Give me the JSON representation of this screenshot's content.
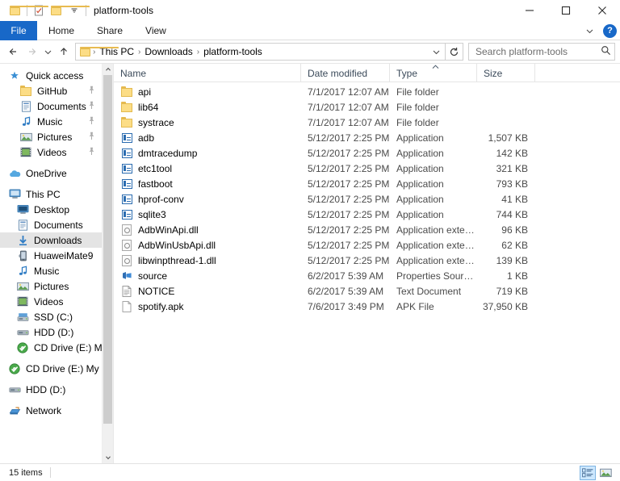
{
  "window": {
    "title": "platform-tools",
    "quick_access_toolbar": [
      {
        "name": "folder-icon",
        "label": ""
      },
      {
        "name": "properties-icon",
        "label": ""
      },
      {
        "name": "new-folder-icon",
        "label": ""
      },
      {
        "name": "chevron-down-icon",
        "label": ""
      }
    ],
    "controls": {
      "minimize": "Minimize",
      "maximize": "Maximize",
      "close": "Close"
    }
  },
  "ribbon": {
    "tabs": [
      {
        "label": "File",
        "active": true
      },
      {
        "label": "Home",
        "active": false
      },
      {
        "label": "Share",
        "active": false
      },
      {
        "label": "View",
        "active": false
      }
    ],
    "expand_label": "",
    "help_label": "?"
  },
  "navigation": {
    "back": "Back",
    "forward": "Forward",
    "recent": "Recent locations",
    "up": "Up",
    "breadcrumbs": [
      "This PC",
      "Downloads",
      "platform-tools"
    ],
    "separator": "›",
    "refresh": "Refresh"
  },
  "search": {
    "placeholder": "Search platform-tools",
    "value": "Search platform-tools"
  },
  "sidebar": {
    "groups": [
      {
        "header": {
          "label": "Quick access",
          "icon": "star-pin-icon"
        },
        "items": [
          {
            "label": "GitHub",
            "icon": "folder-icon",
            "pinned": true,
            "indent": 1
          },
          {
            "label": "Documents",
            "icon": "documents-icon",
            "pinned": true,
            "indent": 1
          },
          {
            "label": "Music",
            "icon": "music-note-icon",
            "pinned": true,
            "indent": 1
          },
          {
            "label": "Pictures",
            "icon": "pictures-icon",
            "pinned": true,
            "indent": 1
          },
          {
            "label": "Videos",
            "icon": "videos-icon",
            "pinned": true,
            "indent": 1
          }
        ]
      },
      {
        "header": {
          "label": "OneDrive",
          "icon": "onedrive-cloud-icon"
        },
        "items": []
      },
      {
        "header": {
          "label": "This PC",
          "icon": "this-pc-icon"
        },
        "items": [
          {
            "label": "Desktop",
            "icon": "desktop-icon",
            "indent": 1
          },
          {
            "label": "Documents",
            "icon": "documents-icon",
            "indent": 1
          },
          {
            "label": "Downloads",
            "icon": "downloads-icon",
            "indent": 1,
            "selected": true
          },
          {
            "label": "HuaweiMate9",
            "icon": "phone-icon",
            "indent": 1
          },
          {
            "label": "Music",
            "icon": "music-note-icon",
            "indent": 1
          },
          {
            "label": "Pictures",
            "icon": "pictures-icon",
            "indent": 1
          },
          {
            "label": "Videos",
            "icon": "videos-icon",
            "indent": 1
          },
          {
            "label": "SSD (C:)",
            "icon": "ssd-drive-icon",
            "indent": 1
          },
          {
            "label": "HDD (D:)",
            "icon": "hdd-drive-icon",
            "indent": 1
          },
          {
            "label": "CD Drive (E:) My",
            "icon": "cd-drive-icon",
            "indent": 1
          }
        ]
      },
      {
        "header": {
          "label": "CD Drive (E:) My C",
          "icon": "cd-drive-icon"
        },
        "items": []
      },
      {
        "header": {
          "label": "HDD (D:)",
          "icon": "hdd-drive-icon"
        },
        "items": []
      },
      {
        "header": {
          "label": "Network",
          "icon": "network-icon"
        },
        "items": []
      }
    ]
  },
  "file_list": {
    "columns": [
      {
        "label": "Name",
        "sorted": false
      },
      {
        "label": "Date modified",
        "sorted": false
      },
      {
        "label": "Type",
        "sorted": true,
        "direction": "asc"
      },
      {
        "label": "Size",
        "sorted": false
      }
    ],
    "rows": [
      {
        "name": "api",
        "date": "7/1/2017 12:07 AM",
        "type": "File folder",
        "size": "",
        "icon": "folder-icon"
      },
      {
        "name": "lib64",
        "date": "7/1/2017 12:07 AM",
        "type": "File folder",
        "size": "",
        "icon": "folder-icon"
      },
      {
        "name": "systrace",
        "date": "7/1/2017 12:07 AM",
        "type": "File folder",
        "size": "",
        "icon": "folder-icon"
      },
      {
        "name": "adb",
        "date": "5/12/2017 2:25 PM",
        "type": "Application",
        "size": "1,507 KB",
        "icon": "application-icon"
      },
      {
        "name": "dmtracedump",
        "date": "5/12/2017 2:25 PM",
        "type": "Application",
        "size": "142 KB",
        "icon": "application-icon"
      },
      {
        "name": "etc1tool",
        "date": "5/12/2017 2:25 PM",
        "type": "Application",
        "size": "321 KB",
        "icon": "application-icon"
      },
      {
        "name": "fastboot",
        "date": "5/12/2017 2:25 PM",
        "type": "Application",
        "size": "793 KB",
        "icon": "application-icon"
      },
      {
        "name": "hprof-conv",
        "date": "5/12/2017 2:25 PM",
        "type": "Application",
        "size": "41 KB",
        "icon": "application-icon"
      },
      {
        "name": "sqlite3",
        "date": "5/12/2017 2:25 PM",
        "type": "Application",
        "size": "744 KB",
        "icon": "application-icon"
      },
      {
        "name": "AdbWinApi.dll",
        "date": "5/12/2017 2:25 PM",
        "type": "Application extens...",
        "size": "96 KB",
        "icon": "dll-icon"
      },
      {
        "name": "AdbWinUsbApi.dll",
        "date": "5/12/2017 2:25 PM",
        "type": "Application extens...",
        "size": "62 KB",
        "icon": "dll-icon"
      },
      {
        "name": "libwinpthread-1.dll",
        "date": "5/12/2017 2:25 PM",
        "type": "Application extens...",
        "size": "139 KB",
        "icon": "dll-icon"
      },
      {
        "name": "source",
        "date": "6/2/2017 5:39 AM",
        "type": "Properties Source ...",
        "size": "1 KB",
        "icon": "properties-source-icon"
      },
      {
        "name": "NOTICE",
        "date": "6/2/2017 5:39 AM",
        "type": "Text Document",
        "size": "719 KB",
        "icon": "text-document-icon"
      },
      {
        "name": "spotify.apk",
        "date": "7/6/2017 3:49 PM",
        "type": "APK File",
        "size": "37,950 KB",
        "icon": "blank-file-icon"
      }
    ]
  },
  "status": {
    "item_count": "15 items",
    "views": [
      {
        "name": "details-view-button",
        "active": true
      },
      {
        "name": "large-icons-view-button",
        "active": false
      }
    ]
  },
  "colors": {
    "accent": "#1868c8",
    "selection": "#e4e4e4",
    "folder": "#fcdd86",
    "header_text": "#3b4a5a"
  }
}
